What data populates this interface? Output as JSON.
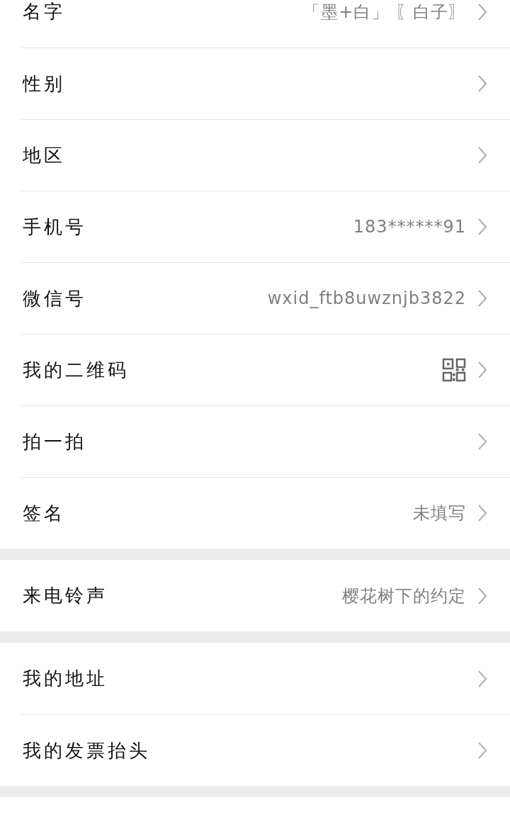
{
  "groups": [
    {
      "rows": [
        {
          "label": "名字",
          "kind": "text",
          "value": "「墨+白」 〖白子〗"
        },
        {
          "label": "性别",
          "kind": "plain"
        },
        {
          "label": "地区",
          "kind": "plain"
        },
        {
          "label": "手机号",
          "kind": "text",
          "value": "183******91"
        },
        {
          "label": "微信号",
          "kind": "text",
          "value": "wxid_ftb8uwznjb3822"
        },
        {
          "label": "我的二维码",
          "kind": "qr"
        },
        {
          "label": "拍一拍",
          "kind": "plain"
        },
        {
          "label": "签名",
          "kind": "text",
          "value": "未填写"
        }
      ]
    },
    {
      "rows": [
        {
          "label": "来电铃声",
          "kind": "text",
          "value": "樱花树下的约定"
        }
      ]
    },
    {
      "rows": [
        {
          "label": "我的地址",
          "kind": "plain"
        },
        {
          "label": "我的发票抬头",
          "kind": "plain"
        }
      ]
    }
  ]
}
